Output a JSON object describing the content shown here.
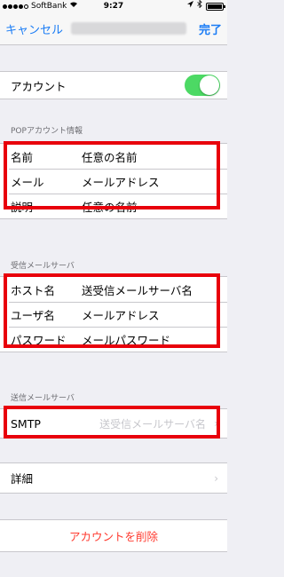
{
  "status_bar": {
    "carrier": "SoftBank",
    "time": "9:27"
  },
  "nav": {
    "cancel": "キャンセル",
    "done": "完了"
  },
  "account": {
    "label": "アカウント",
    "enabled": true
  },
  "pop": {
    "header": "POPアカウント情報",
    "rows": [
      {
        "label": "名前",
        "value": "任意の名前"
      },
      {
        "label": "メール",
        "value": "メールアドレス"
      },
      {
        "label": "説明",
        "value": "任意の名前"
      }
    ]
  },
  "incoming": {
    "header": "受信メールサーバ",
    "rows": [
      {
        "label": "ホスト名",
        "value": "送受信メールサーバ名"
      },
      {
        "label": "ユーザ名",
        "value": "メールアドレス"
      },
      {
        "label": "パスワード",
        "value": "メールパスワード"
      }
    ]
  },
  "outgoing": {
    "header": "送信メールサーバ",
    "smtp_label": "SMTP",
    "smtp_value": "送受信メールサーバ名"
  },
  "details": {
    "label": "詳細"
  },
  "delete": {
    "label": "アカウントを削除"
  },
  "colors": {
    "accent": "#1a7cf5",
    "toggle_on": "#4cd964",
    "highlight": "#e8000b",
    "destructive": "#ff3b30"
  }
}
